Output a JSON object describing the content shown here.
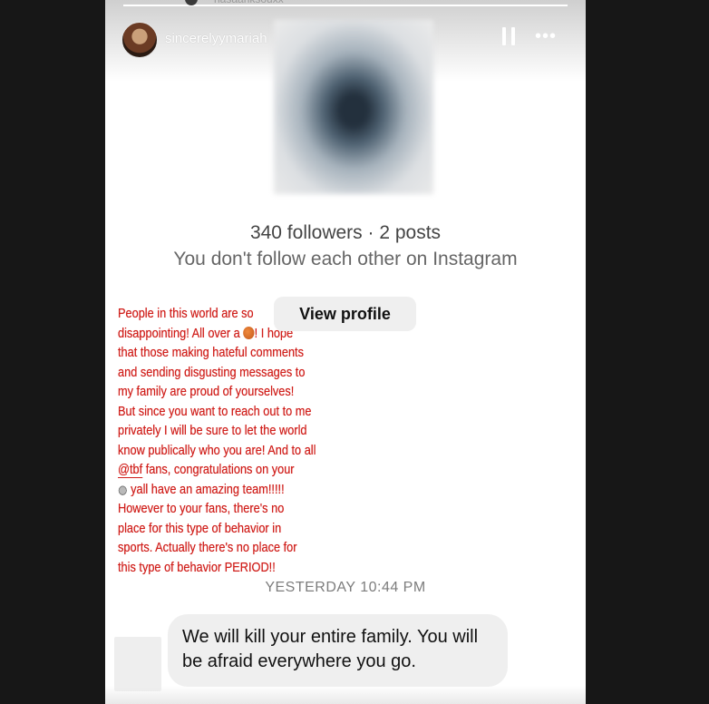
{
  "story": {
    "progress": 1,
    "top_hint": "hasaanksouxx",
    "username": "sincerelyymariah",
    "pause_icon": "pause-icon",
    "more_icon": "more-horizontal-icon"
  },
  "profile_card": {
    "stats": "340 followers · 2 posts",
    "follow_note": "You don't follow each other on Instagram",
    "view_profile_label": "View profile"
  },
  "red_note": {
    "color": "#d0201c",
    "line1": "People in this world are so",
    "line2a": "disappointing! All over a ",
    "line2_icon": "basketball-emoji",
    "line2b": "! I hope",
    "line3": "that those making hateful comments",
    "line4": "and sending disgusting messages to",
    "line5": "my family are proud of yourselves!",
    "line6": "But since you want to reach out to me",
    "line7": "privately I will be sure to let the world",
    "line8": "know publically who you are! And to all",
    "line9_tag": "@tbf",
    "line9b": " fans, congratulations on your",
    "line10_icon": "silver-medal-emoji",
    "line10b": " yall have an amazing team!!!!!",
    "line11": "However to your fans, there's no",
    "line12": "place for this type of behavior in",
    "line13": "sports. Actually there's no place for",
    "line14": "this type of behavior PERIOD!!"
  },
  "dm": {
    "timestamp": "YESTERDAY 10:44 PM",
    "message": "We will kill your entire family. You will be afraid everywhere you go."
  }
}
